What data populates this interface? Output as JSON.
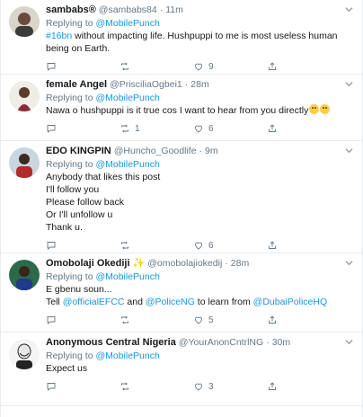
{
  "tweets": [
    {
      "name": "sambabs®",
      "handle": "@sambabs84",
      "time": "11m",
      "replying_label": "Replying to ",
      "replying_to": "@MobilePunch",
      "hashtag": "#16bn",
      "text": " without impacting life. Hushpuppi to me is most useless human being on Earth.",
      "replies": "",
      "retweets": "",
      "likes": "9"
    },
    {
      "name": "female Angel",
      "handle": "@PrisciliaOgbei1",
      "time": "28m",
      "replying_label": "Replying to ",
      "replying_to": "@MobilePunch",
      "text": "Nawa o hushpuppi is it true cos I want to hear from you directly",
      "emojis": [
        "confused-face-emoji",
        "confused-face-emoji"
      ],
      "replies": "",
      "retweets": "1",
      "likes": "6"
    },
    {
      "name": "EDO KINGPIN",
      "handle": "@Huncho_Goodlife",
      "time": "9m",
      "replying_label": "Replying to ",
      "replying_to": "@MobilePunch",
      "lines": [
        "Anybody that likes this post",
        "I'll follow you",
        "Please follow back",
        "Or I'll unfollow u",
        "Thank u."
      ],
      "replies": "",
      "retweets": "",
      "likes": "6"
    },
    {
      "name": "Omobolaji Okediji",
      "badge": "✨",
      "handle": "@omobolajiokedij",
      "time": "28m",
      "replying_label": "Replying to ",
      "replying_to": "@MobilePunch",
      "line1": "E gbenu soun...",
      "line2_a": "Tell ",
      "mention1": "@officialEFCC",
      "line2_b": " and ",
      "mention2": "@PoliceNG",
      "line2_c": " to learn from ",
      "mention3": "@DubaiPoliceHQ",
      "replies": "",
      "retweets": "",
      "likes": "5"
    },
    {
      "name": "Anonymous Central Nigeria",
      "handle": "@YourAnonCntrlNG",
      "time": "30m",
      "replying_label": "Replying to ",
      "replying_to": "@MobilePunch",
      "text": "Expect us",
      "replies": "",
      "retweets": "",
      "likes": "3"
    }
  ],
  "separator": "·",
  "colors": {
    "link": "#1b95e0",
    "muted": "#657786",
    "border": "#e6ecf0"
  }
}
